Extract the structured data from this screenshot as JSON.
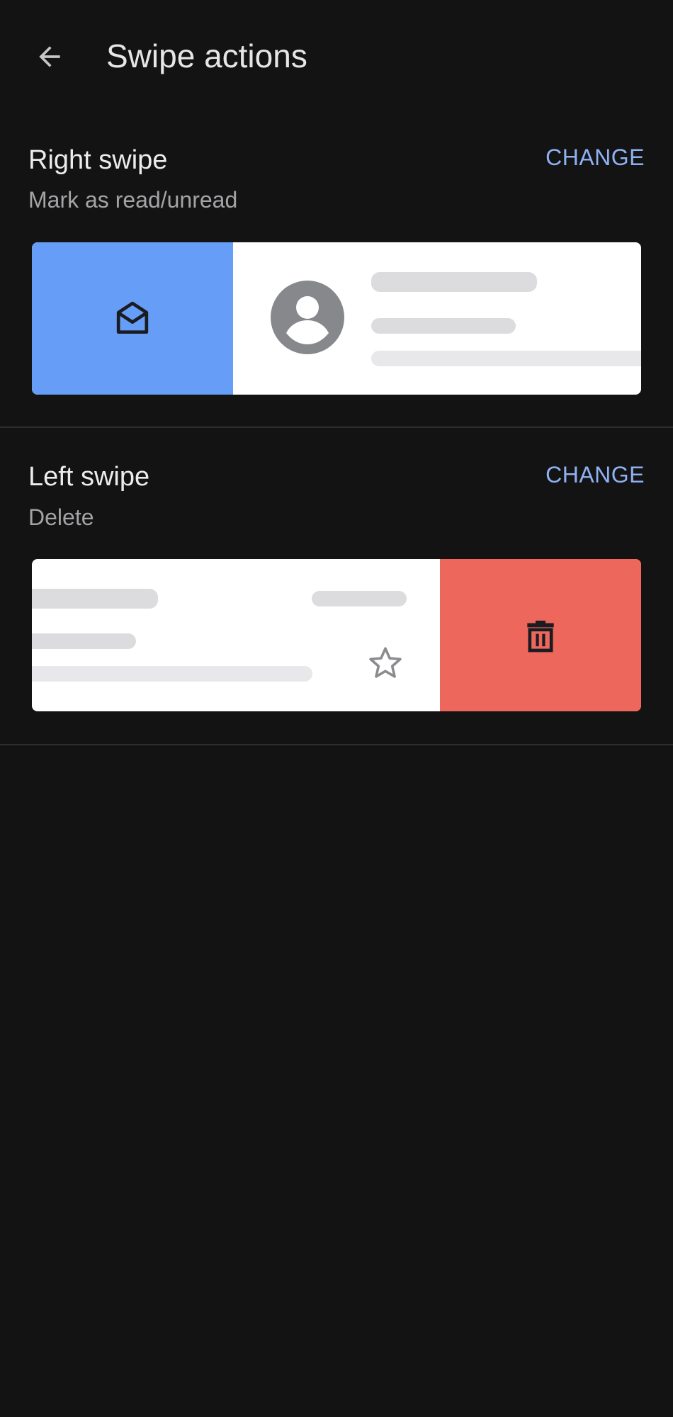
{
  "app_bar": {
    "title": "Swipe actions",
    "back_icon": "arrow-back-icon"
  },
  "right_swipe": {
    "title": "Right swipe",
    "action": "Mark as read/unread",
    "change_label": "CHANGE",
    "action_color": "#669df6",
    "action_icon": "mail-open-icon"
  },
  "left_swipe": {
    "title": "Left swipe",
    "action": "Delete",
    "change_label": "CHANGE",
    "action_color": "#ee675c",
    "action_icon": "trash-icon"
  },
  "colors": {
    "background": "#131314",
    "accent": "#8fb1f3",
    "divider": "#2e2e30"
  }
}
